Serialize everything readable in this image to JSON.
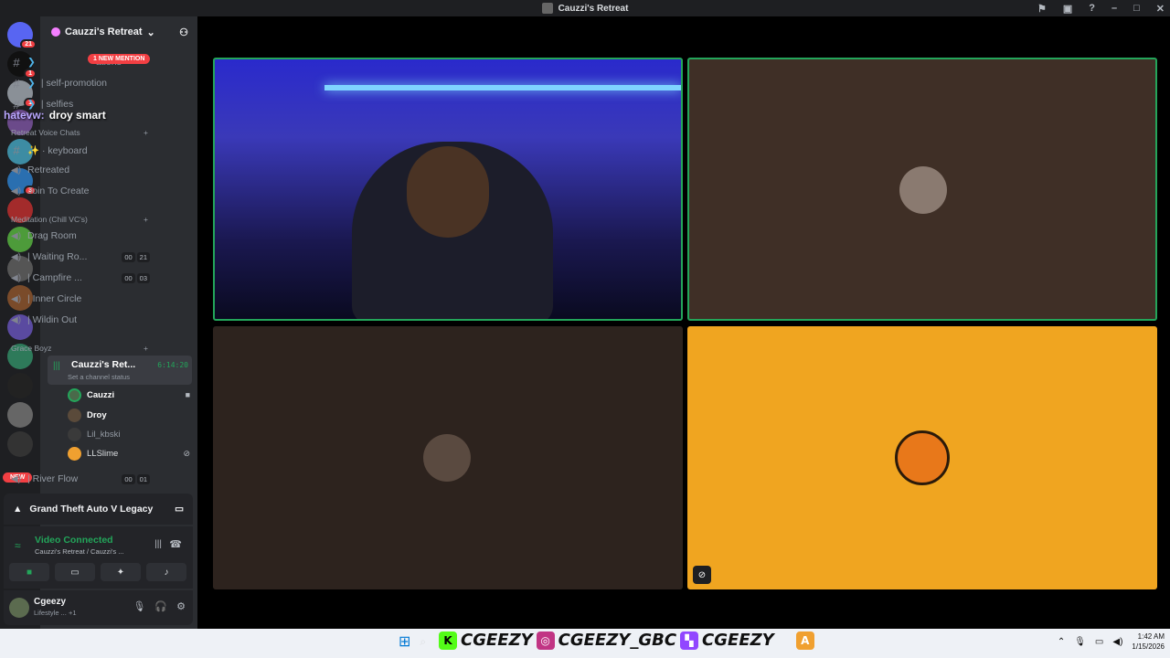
{
  "window": {
    "title": "Cauzzi's Retreat"
  },
  "server": {
    "name": "Cauzzi's Retreat"
  },
  "mention_badge": "1 NEW MENTION",
  "new_badge": "NEW",
  "server_badges": [
    "21",
    "1",
    "1",
    "3"
  ],
  "overlay_chat": {
    "user": "hatevw:",
    "message": "droy smart"
  },
  "channels_text": [
    {
      "label": "ations"
    },
    {
      "label": "| self-promotion"
    },
    {
      "label": "| selfies"
    }
  ],
  "categories": {
    "voice": "Retreat Voice Chats",
    "meditation": "Meditation (Chill VC's)",
    "grace": "Grace Boyz"
  },
  "voice_channels": [
    {
      "label": "✨ · keyboard"
    },
    {
      "label": "Retreated"
    },
    {
      "label": "Join To Create"
    }
  ],
  "meditation_channels": [
    {
      "label": "Drag Room"
    },
    {
      "label": "| Waiting Ro...",
      "count_a": "00",
      "count_b": "21"
    },
    {
      "label": "| Campfire ...",
      "count_a": "00",
      "count_b": "03"
    },
    {
      "label": "| Inner Circle"
    },
    {
      "label": "| Wildin Out"
    }
  ],
  "active_vc": {
    "name": "Cauzzi's Ret...",
    "status": "Set a channel status",
    "timer": "6:14:20"
  },
  "vc_users": [
    "Cauzzi",
    "Droy",
    "Lil_kbski",
    "LLSlime"
  ],
  "river_flow": {
    "label": "| River Flow",
    "count_a": "00",
    "count_b": "01"
  },
  "game": {
    "name": "Grand Theft Auto V Legacy"
  },
  "voice_status": {
    "title": "Video Connected",
    "subtitle": "Cauzzi's Retreat / Cauzzi's ..."
  },
  "user": {
    "name": "Cgeezy",
    "status": "Lifestyle ...",
    "extra": "+1"
  },
  "taskbar": {
    "socials": [
      "CGEEZY",
      "CGEEZY_GBC",
      "CGEEZY"
    ],
    "time": "1:42 AM",
    "date": "1/15/2026"
  }
}
